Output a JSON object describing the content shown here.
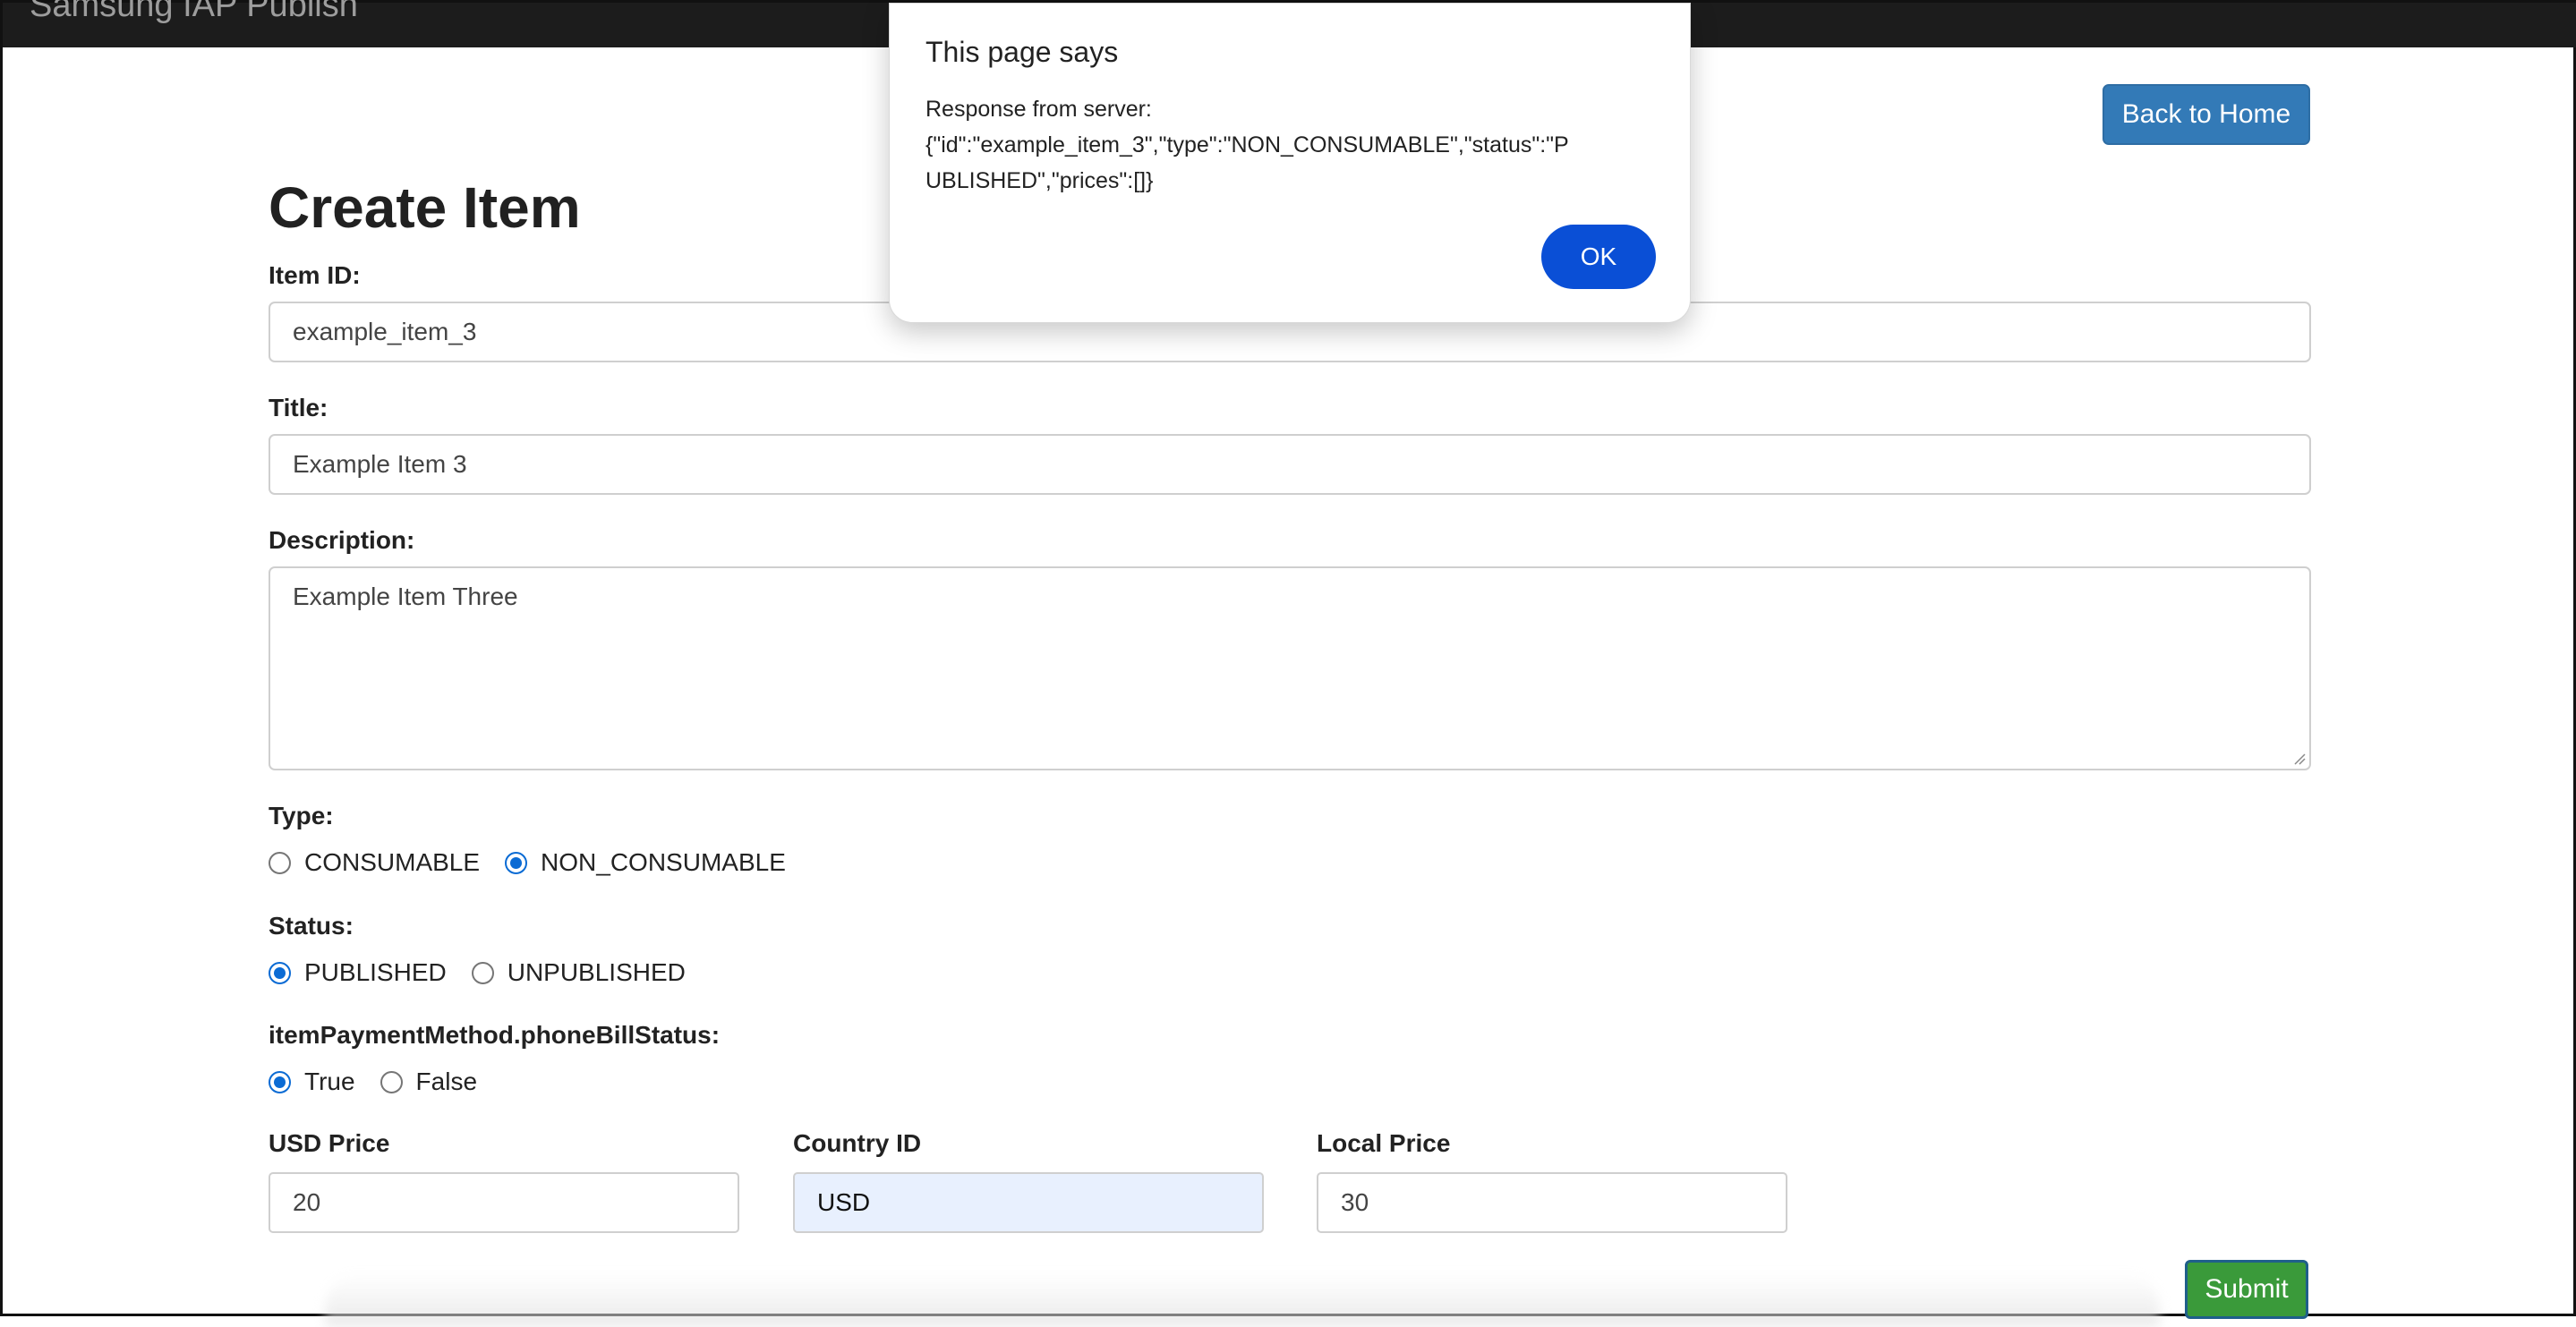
{
  "navbar": {
    "brand": "Samsung IAP Publish"
  },
  "header": {
    "back_label": "Back to Home"
  },
  "form": {
    "title": "Create Item",
    "item_id_label": "Item ID:",
    "item_id_value": "example_item_3",
    "title_label": "Title:",
    "title_value": "Example Item 3",
    "description_label": "Description:",
    "description_value": "Example Item Three",
    "type_label": "Type:",
    "type_options": [
      {
        "label": "CONSUMABLE",
        "checked": false
      },
      {
        "label": "NON_CONSUMABLE",
        "checked": true
      }
    ],
    "status_label": "Status:",
    "status_options": [
      {
        "label": "PUBLISHED",
        "checked": true
      },
      {
        "label": "UNPUBLISHED",
        "checked": false
      }
    ],
    "phone_bill_label": "itemPaymentMethod.phoneBillStatus:",
    "phone_bill_options": [
      {
        "label": "True",
        "checked": true
      },
      {
        "label": "False",
        "checked": false
      }
    ],
    "usd_price_label": "USD Price",
    "usd_price_value": "20",
    "country_id_label": "Country ID",
    "country_id_value": "USD",
    "local_price_label": "Local Price",
    "local_price_value": "30",
    "submit_label": "Submit"
  },
  "dialog": {
    "title": "This page says",
    "message_line1": "Response from server:",
    "message_line2": "{\"id\":\"example_item_3\",\"type\":\"NON_CONSUMABLE\",\"status\":\"P",
    "message_line3": "UBLISHED\",\"prices\":[]}",
    "ok_label": "OK"
  },
  "colors": {
    "navbar": "#1c1c1c",
    "primary_button": "#337ab7",
    "submit_button": "#3a9a3a",
    "radio_checked": "#0b6bd4",
    "dialog_ok": "#0a4fd6",
    "autofill_bg": "#e8f0fe"
  }
}
